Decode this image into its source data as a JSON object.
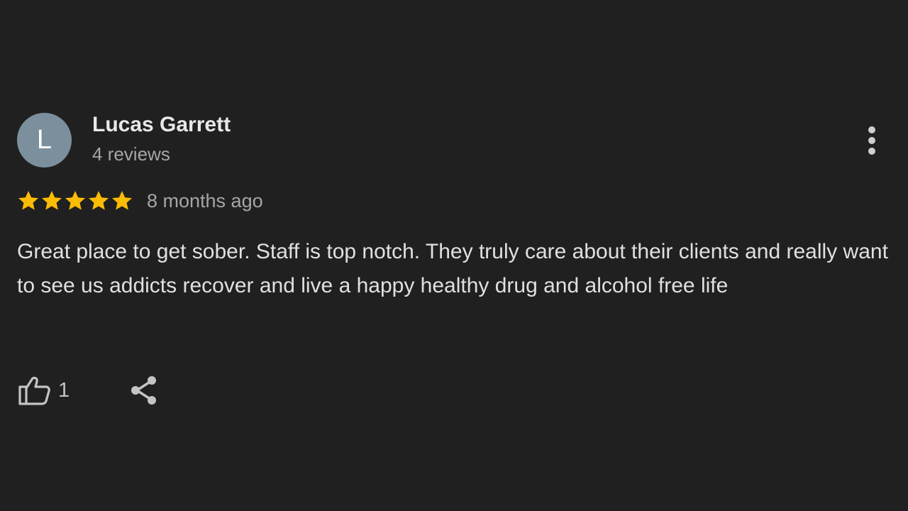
{
  "review": {
    "avatar_letter": "L",
    "author_name": "Lucas Garrett",
    "review_count": "4 reviews",
    "rating": 5,
    "rating_max": 5,
    "time": "8 months ago",
    "text": "Great place to get sober. Staff is top notch. They truly care about their clients and really want to see us addicts recover and live a happy healthy drug and alcohol free life",
    "likes": "1"
  },
  "colors": {
    "background": "#202020",
    "avatar": "#7b909c",
    "star": "#fbbc04",
    "text_primary": "#e8e8e8",
    "text_secondary": "#a6a6a6"
  },
  "icons": {
    "more": "more-vertical-icon",
    "like": "thumbs-up-icon",
    "share": "share-icon",
    "star": "star-icon"
  }
}
